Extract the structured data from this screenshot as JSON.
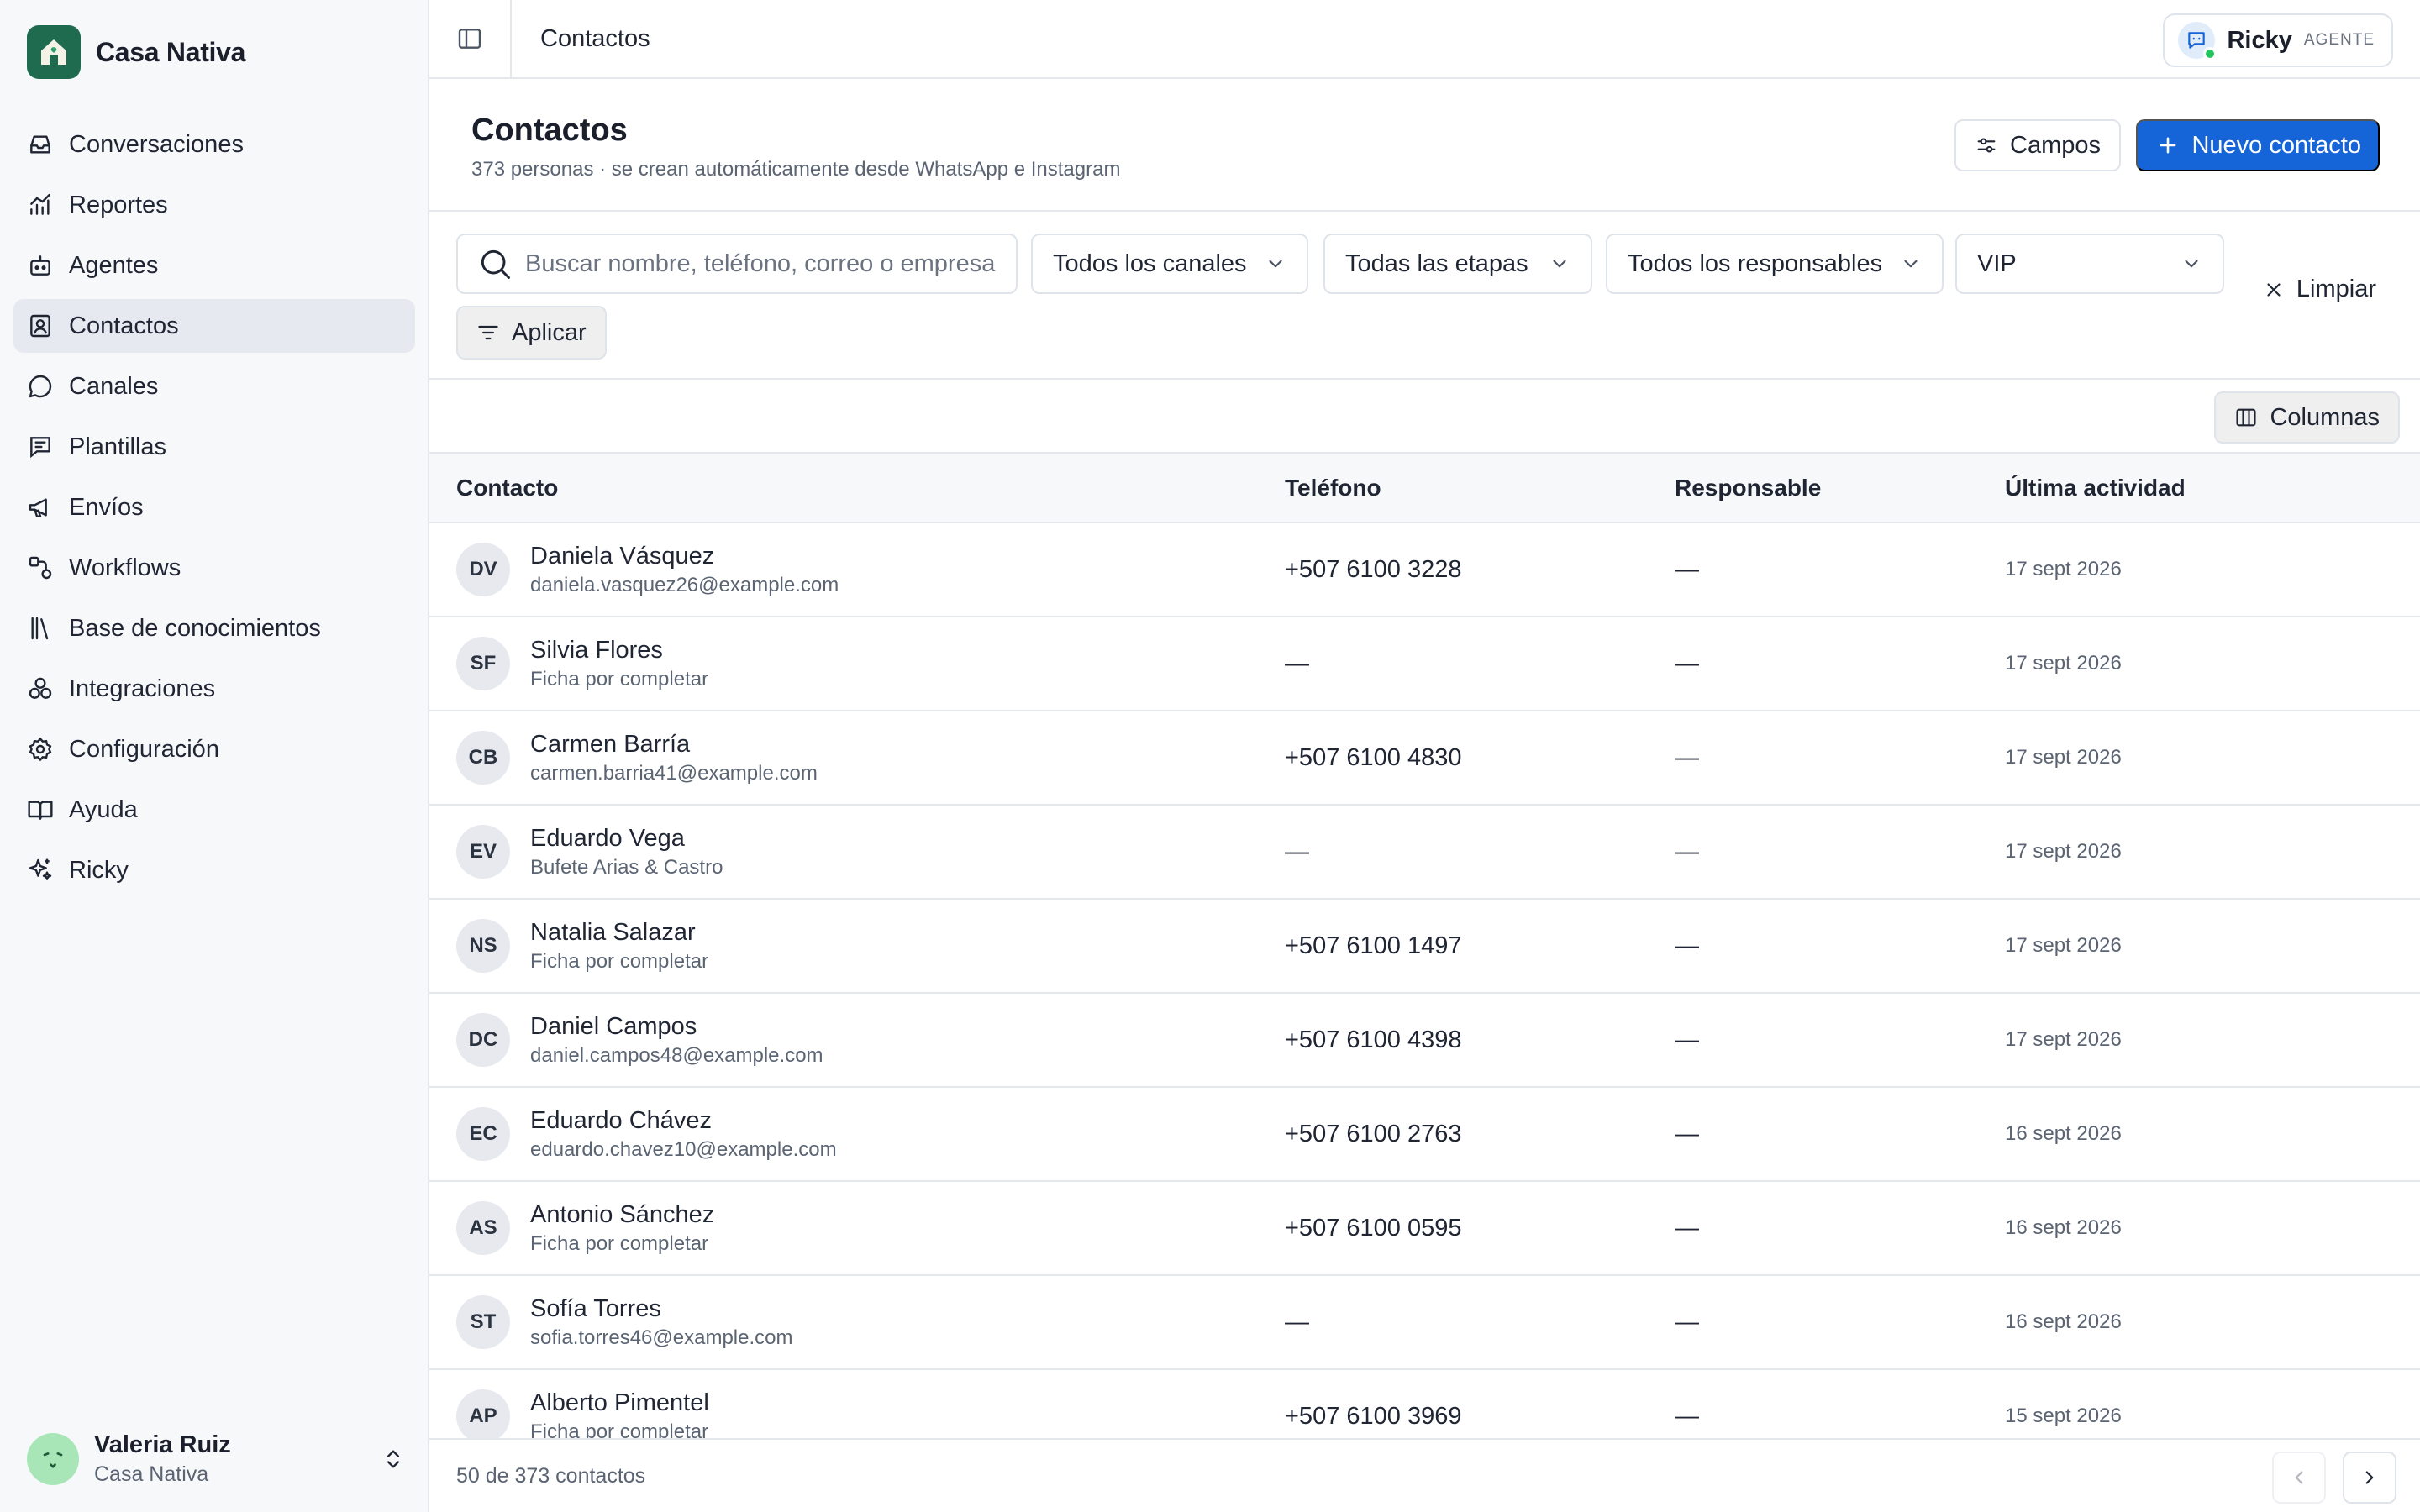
{
  "brand": {
    "name": "Casa Nativa",
    "logo_color": "#1f6b4f"
  },
  "sidebar": {
    "items": [
      {
        "label": "Conversaciones",
        "icon": "inbox-icon",
        "active": false
      },
      {
        "label": "Reportes",
        "icon": "chart-icon",
        "active": false
      },
      {
        "label": "Agentes",
        "icon": "bot-icon",
        "active": false
      },
      {
        "label": "Contactos",
        "icon": "contacts-icon",
        "active": true
      },
      {
        "label": "Canales",
        "icon": "chat-bubble-icon",
        "active": false
      },
      {
        "label": "Plantillas",
        "icon": "template-icon",
        "active": false
      },
      {
        "label": "Envíos",
        "icon": "megaphone-icon",
        "active": false
      },
      {
        "label": "Workflows",
        "icon": "workflow-icon",
        "active": false
      },
      {
        "label": "Base de conocimientos",
        "icon": "library-icon",
        "active": false
      },
      {
        "label": "Integraciones",
        "icon": "integrations-icon",
        "active": false
      },
      {
        "label": "Configuración",
        "icon": "gear-icon",
        "active": false
      },
      {
        "label": "Ayuda",
        "icon": "book-icon",
        "active": false
      },
      {
        "label": "Ricky",
        "icon": "sparkles-icon",
        "active": false
      }
    ],
    "user": {
      "name": "Valeria Ruiz",
      "org": "Casa Nativa"
    }
  },
  "topbar": {
    "breadcrumb": "Contactos",
    "agent": {
      "name": "Ricky",
      "tag": "AGENTE",
      "status_color": "#22c55e"
    }
  },
  "page": {
    "title": "Contactos",
    "subtitle": "373 personas · se crean automáticamente desde WhatsApp e Instagram",
    "campos_label": "Campos",
    "nuevo_label": "Nuevo contacto",
    "accent": "#1565d8"
  },
  "filters": {
    "search_placeholder": "Buscar nombre, teléfono, correo o empresa",
    "canales": "Todos los canales",
    "etapas": "Todas las etapas",
    "responsables": "Todos los responsables",
    "segmento": "VIP",
    "limpiar_label": "Limpiar",
    "aplicar_label": "Aplicar"
  },
  "columns_label": "Columnas",
  "table": {
    "headers": [
      "Contacto",
      "Teléfono",
      "Responsable",
      "Última actividad"
    ],
    "rows": [
      {
        "initials": "DV",
        "name": "Daniela Vásquez",
        "sub": "daniela.vasquez26@example.com",
        "phone": "+507 6100 3228",
        "owner": "—",
        "date": "17 sept 2026"
      },
      {
        "initials": "SF",
        "name": "Silvia Flores",
        "sub": "Ficha por completar",
        "phone": "—",
        "owner": "—",
        "date": "17 sept 2026"
      },
      {
        "initials": "CB",
        "name": "Carmen Barría",
        "sub": "carmen.barria41@example.com",
        "phone": "+507 6100 4830",
        "owner": "—",
        "date": "17 sept 2026"
      },
      {
        "initials": "EV",
        "name": "Eduardo Vega",
        "sub": "Bufete Arias & Castro",
        "phone": "—",
        "owner": "—",
        "date": "17 sept 2026"
      },
      {
        "initials": "NS",
        "name": "Natalia Salazar",
        "sub": "Ficha por completar",
        "phone": "+507 6100 1497",
        "owner": "—",
        "date": "17 sept 2026"
      },
      {
        "initials": "DC",
        "name": "Daniel Campos",
        "sub": "daniel.campos48@example.com",
        "phone": "+507 6100 4398",
        "owner": "—",
        "date": "17 sept 2026"
      },
      {
        "initials": "EC",
        "name": "Eduardo Chávez",
        "sub": "eduardo.chavez10@example.com",
        "phone": "+507 6100 2763",
        "owner": "—",
        "date": "16 sept 2026"
      },
      {
        "initials": "AS",
        "name": "Antonio Sánchez",
        "sub": "Ficha por completar",
        "phone": "+507 6100 0595",
        "owner": "—",
        "date": "16 sept 2026"
      },
      {
        "initials": "ST",
        "name": "Sofía Torres",
        "sub": "sofia.torres46@example.com",
        "phone": "—",
        "owner": "—",
        "date": "16 sept 2026"
      },
      {
        "initials": "AP",
        "name": "Alberto Pimentel",
        "sub": "Ficha por completar",
        "phone": "+507 6100 3969",
        "owner": "—",
        "date": "15 sept 2026"
      }
    ]
  },
  "footer": {
    "count_text": "50 de 373 contactos"
  }
}
